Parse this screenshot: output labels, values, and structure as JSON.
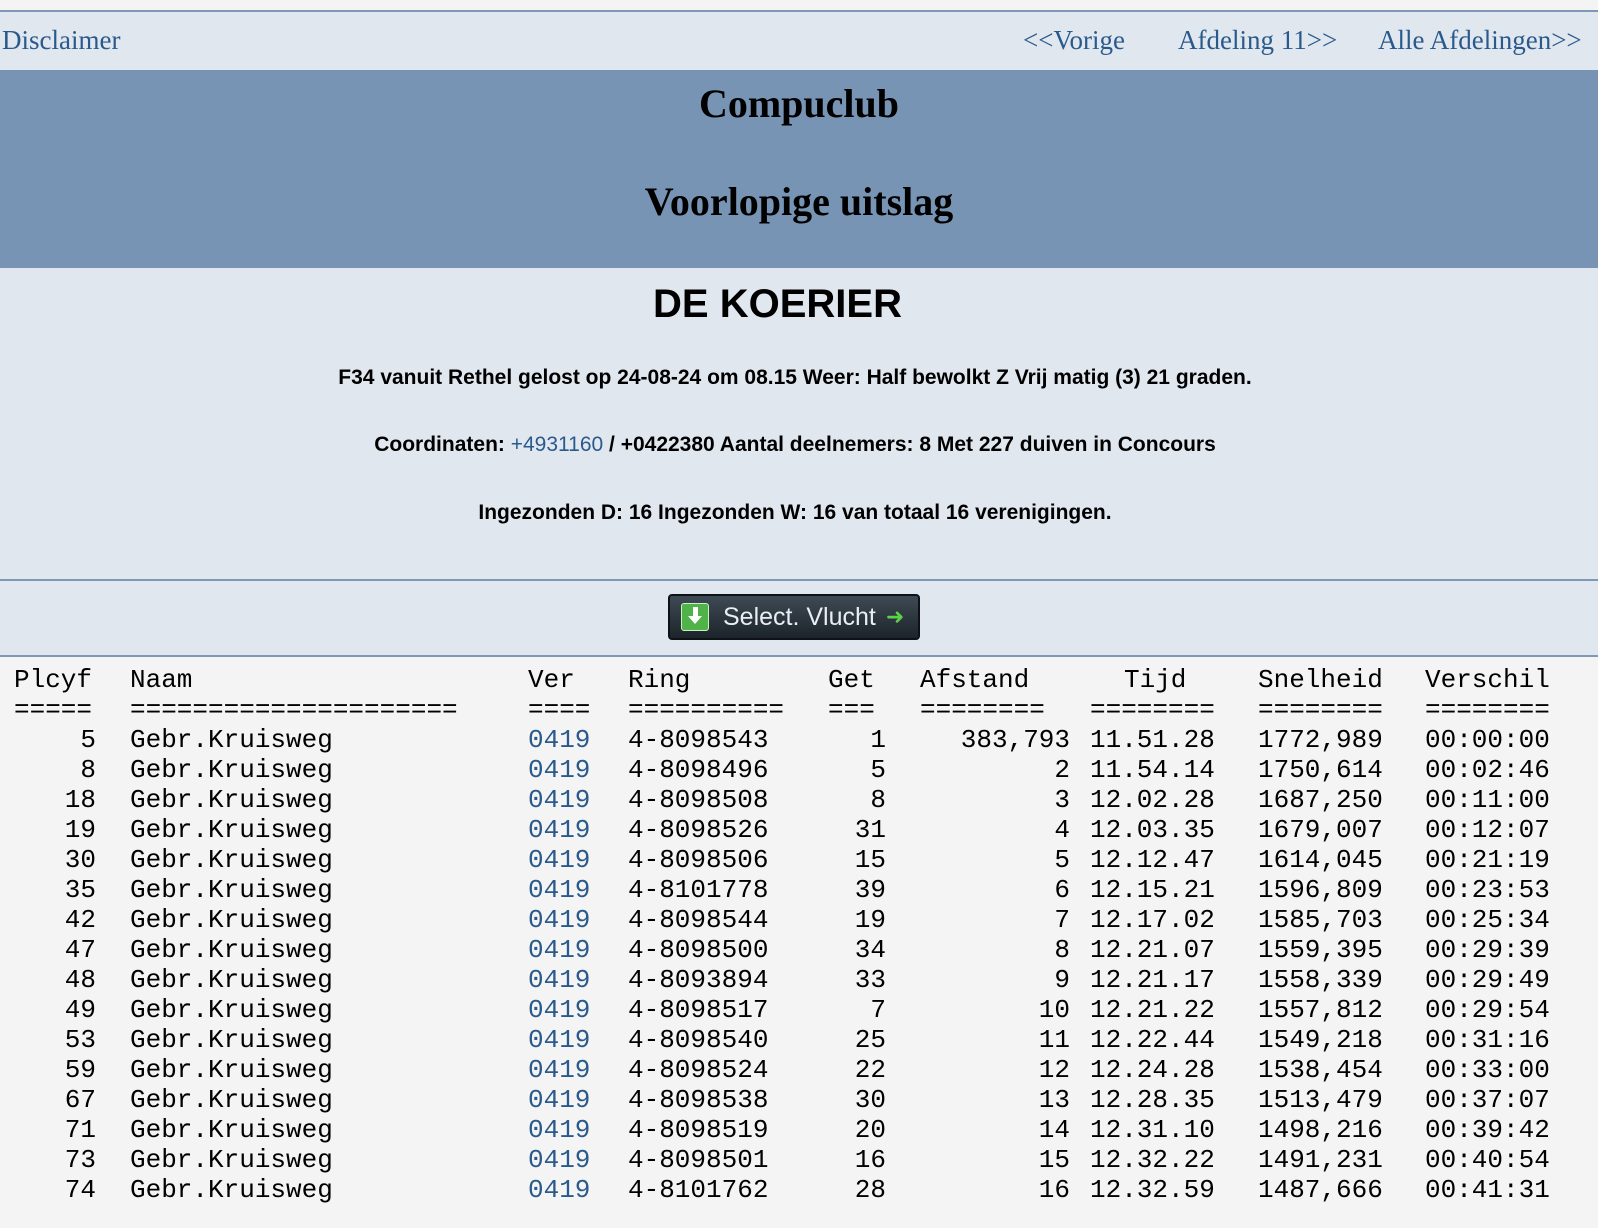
{
  "nav": {
    "disclaimer": "Disclaimer",
    "prev": "<<Vorige",
    "afdeling": "Afdeling 11>>",
    "all": "Alle Afdelingen>>"
  },
  "banner": {
    "title": "Compuclub",
    "subtitle": "Voorlopige uitslag"
  },
  "info": {
    "club": "DE KOERIER",
    "line1": "F34 vanuit Rethel gelost op 24-08-24 om 08.15 Weer: Half bewolkt Z Vrij matig (3) 21 graden.",
    "coord_label": "Coordinaten: ",
    "coord_link": "+4931160",
    "coord_rest": " / +0422380 Aantal deelnemers: 8 Met 227 duiven in Concours",
    "line3": "Ingezonden D: 16 Ingezonden W: 16 van totaal 16 verenigingen."
  },
  "select_button": {
    "label": "Select. Vlucht",
    "icon": "download-icon",
    "arrow_icon": "arrow-right-icon"
  },
  "table": {
    "headers": {
      "plcyf": "Plcyf",
      "naam": "Naam",
      "ver": "Ver",
      "ring": "Ring",
      "get": "Get",
      "afstand": "Afstand",
      "tijd": "Tijd",
      "snelheid": "Snelheid",
      "verschil": "Verschil"
    },
    "separators": {
      "plcyf": "=====",
      "naam": "=====================",
      "ver": "====",
      "ring": "==========",
      "get": "===",
      "afstand": "========",
      "tijd": "========",
      "snelheid": "========",
      "verschil": "========"
    },
    "rows": [
      {
        "plcyf": "5",
        "naam": "Gebr.Kruisweg",
        "ver": "0419",
        "ring": "4-8098543",
        "get": "1",
        "afstand": "383,793",
        "tijd": "11.51.28",
        "snelheid": "1772,989",
        "verschil": "00:00:00"
      },
      {
        "plcyf": "8",
        "naam": "Gebr.Kruisweg",
        "ver": "0419",
        "ring": "4-8098496",
        "get": "5",
        "afstand": "2",
        "tijd": "11.54.14",
        "snelheid": "1750,614",
        "verschil": "00:02:46"
      },
      {
        "plcyf": "18",
        "naam": "Gebr.Kruisweg",
        "ver": "0419",
        "ring": "4-8098508",
        "get": "8",
        "afstand": "3",
        "tijd": "12.02.28",
        "snelheid": "1687,250",
        "verschil": "00:11:00"
      },
      {
        "plcyf": "19",
        "naam": "Gebr.Kruisweg",
        "ver": "0419",
        "ring": "4-8098526",
        "get": "31",
        "afstand": "4",
        "tijd": "12.03.35",
        "snelheid": "1679,007",
        "verschil": "00:12:07"
      },
      {
        "plcyf": "30",
        "naam": "Gebr.Kruisweg",
        "ver": "0419",
        "ring": "4-8098506",
        "get": "15",
        "afstand": "5",
        "tijd": "12.12.47",
        "snelheid": "1614,045",
        "verschil": "00:21:19"
      },
      {
        "plcyf": "35",
        "naam": "Gebr.Kruisweg",
        "ver": "0419",
        "ring": "4-8101778",
        "get": "39",
        "afstand": "6",
        "tijd": "12.15.21",
        "snelheid": "1596,809",
        "verschil": "00:23:53"
      },
      {
        "plcyf": "42",
        "naam": "Gebr.Kruisweg",
        "ver": "0419",
        "ring": "4-8098544",
        "get": "19",
        "afstand": "7",
        "tijd": "12.17.02",
        "snelheid": "1585,703",
        "verschil": "00:25:34"
      },
      {
        "plcyf": "47",
        "naam": "Gebr.Kruisweg",
        "ver": "0419",
        "ring": "4-8098500",
        "get": "34",
        "afstand": "8",
        "tijd": "12.21.07",
        "snelheid": "1559,395",
        "verschil": "00:29:39"
      },
      {
        "plcyf": "48",
        "naam": "Gebr.Kruisweg",
        "ver": "0419",
        "ring": "4-8093894",
        "get": "33",
        "afstand": "9",
        "tijd": "12.21.17",
        "snelheid": "1558,339",
        "verschil": "00:29:49"
      },
      {
        "plcyf": "49",
        "naam": "Gebr.Kruisweg",
        "ver": "0419",
        "ring": "4-8098517",
        "get": "7",
        "afstand": "10",
        "tijd": "12.21.22",
        "snelheid": "1557,812",
        "verschil": "00:29:54"
      },
      {
        "plcyf": "53",
        "naam": "Gebr.Kruisweg",
        "ver": "0419",
        "ring": "4-8098540",
        "get": "25",
        "afstand": "11",
        "tijd": "12.22.44",
        "snelheid": "1549,218",
        "verschil": "00:31:16"
      },
      {
        "plcyf": "59",
        "naam": "Gebr.Kruisweg",
        "ver": "0419",
        "ring": "4-8098524",
        "get": "22",
        "afstand": "12",
        "tijd": "12.24.28",
        "snelheid": "1538,454",
        "verschil": "00:33:00"
      },
      {
        "plcyf": "67",
        "naam": "Gebr.Kruisweg",
        "ver": "0419",
        "ring": "4-8098538",
        "get": "30",
        "afstand": "13",
        "tijd": "12.28.35",
        "snelheid": "1513,479",
        "verschil": "00:37:07"
      },
      {
        "plcyf": "71",
        "naam": "Gebr.Kruisweg",
        "ver": "0419",
        "ring": "4-8098519",
        "get": "20",
        "afstand": "14",
        "tijd": "12.31.10",
        "snelheid": "1498,216",
        "verschil": "00:39:42"
      },
      {
        "plcyf": "73",
        "naam": "Gebr.Kruisweg",
        "ver": "0419",
        "ring": "4-8098501",
        "get": "16",
        "afstand": "15",
        "tijd": "12.32.22",
        "snelheid": "1491,231",
        "verschil": "00:40:54"
      },
      {
        "plcyf": "74",
        "naam": "Gebr.Kruisweg",
        "ver": "0419",
        "ring": "4-8101762",
        "get": "28",
        "afstand": "16",
        "tijd": "12.32.59",
        "snelheid": "1487,666",
        "verschil": "00:41:31"
      }
    ]
  }
}
